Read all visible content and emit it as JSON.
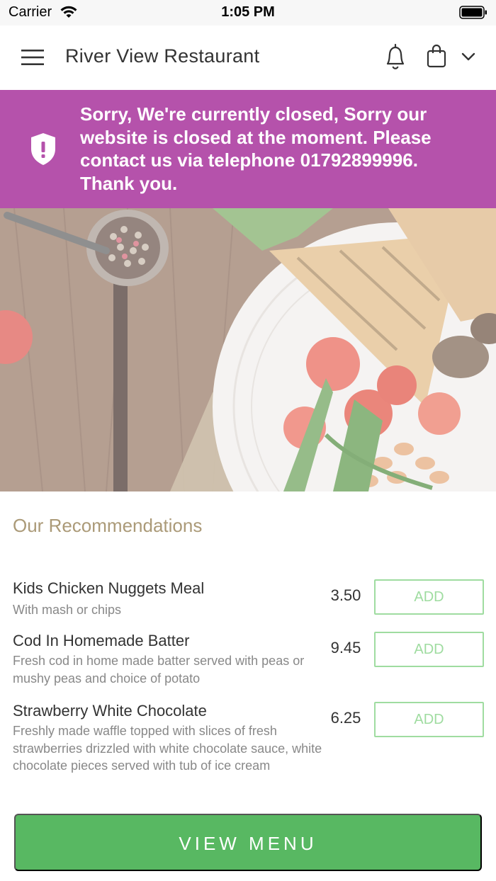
{
  "status_bar": {
    "carrier": "Carrier",
    "time": "1:05 PM"
  },
  "header": {
    "title": "River View Restaurant",
    "icons": [
      "menu-icon",
      "bell-icon",
      "shopping-bag-icon",
      "chevron-down-icon"
    ]
  },
  "banner": {
    "message": "Sorry, We're currently closed, Sorry our website is closed at the moment. Please contact us via telephone 01792899996. Thank you.",
    "icon": "shield-alert-icon",
    "background": "#b552ab"
  },
  "recommendations": {
    "title": "Our Recommendations",
    "items": [
      {
        "name": "Kids Chicken Nuggets Meal",
        "description": "With mash or chips",
        "price": "3.50",
        "button": "ADD"
      },
      {
        "name": "Cod In Homemade Batter",
        "description": "Fresh cod in home made batter served with peas or mushy peas and choice of potato",
        "price": "9.45",
        "button": "ADD"
      },
      {
        "name": "Strawberry White Chocolate",
        "description": "Freshly made waffle topped with slices of fresh strawberries drizzled with white chocolate sauce, white chocolate pieces served with tub of ice cream",
        "price": "6.25",
        "button": "ADD"
      }
    ]
  },
  "view_menu": {
    "label": "VIEW MENU",
    "color": "#58b862"
  },
  "colors": {
    "accent_gold": "#ab9a78",
    "add_green": "#9fdca0"
  }
}
